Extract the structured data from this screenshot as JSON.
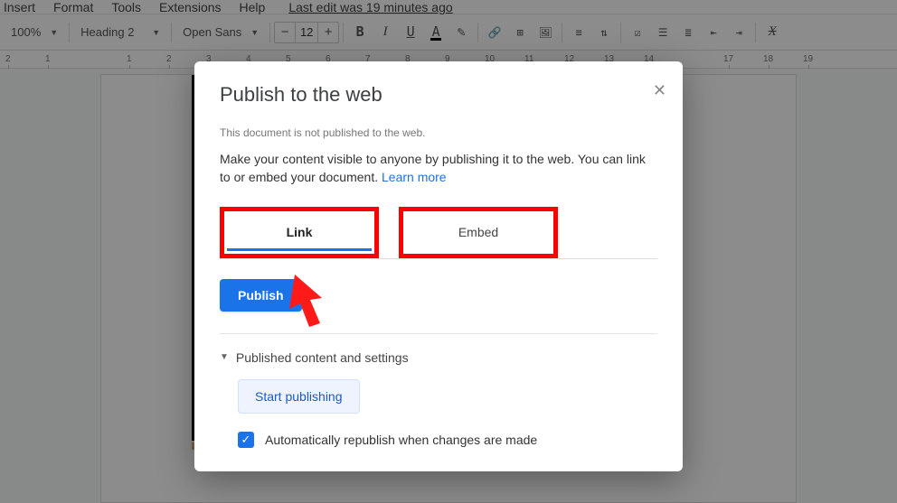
{
  "menubar": {
    "items": [
      "Insert",
      "Format",
      "Tools",
      "Extensions",
      "Help"
    ],
    "last_edit": "Last edit was 19 minutes ago"
  },
  "toolbar": {
    "zoom": "100%",
    "style": "Heading 2",
    "font": "Open Sans",
    "size": "12"
  },
  "ruler": {
    "marks": [
      "2",
      "1",
      "1",
      "2",
      "3",
      "4",
      "5",
      "6",
      "7",
      "8",
      "9",
      "10",
      "11",
      "12",
      "13",
      "14",
      "17",
      "18",
      "19"
    ]
  },
  "dialog": {
    "title": "Publish to the web",
    "subtitle": "This document is not published to the web.",
    "description": "Make your content visible to anyone by publishing it to the web. You can link to or embed your document.",
    "learn_more": "Learn more",
    "tabs": {
      "link": "Link",
      "embed": "Embed"
    },
    "publish": "Publish",
    "expander_label": "Published content and settings",
    "start_publishing": "Start publishing",
    "auto_republish": "Automatically republish when changes are made"
  }
}
